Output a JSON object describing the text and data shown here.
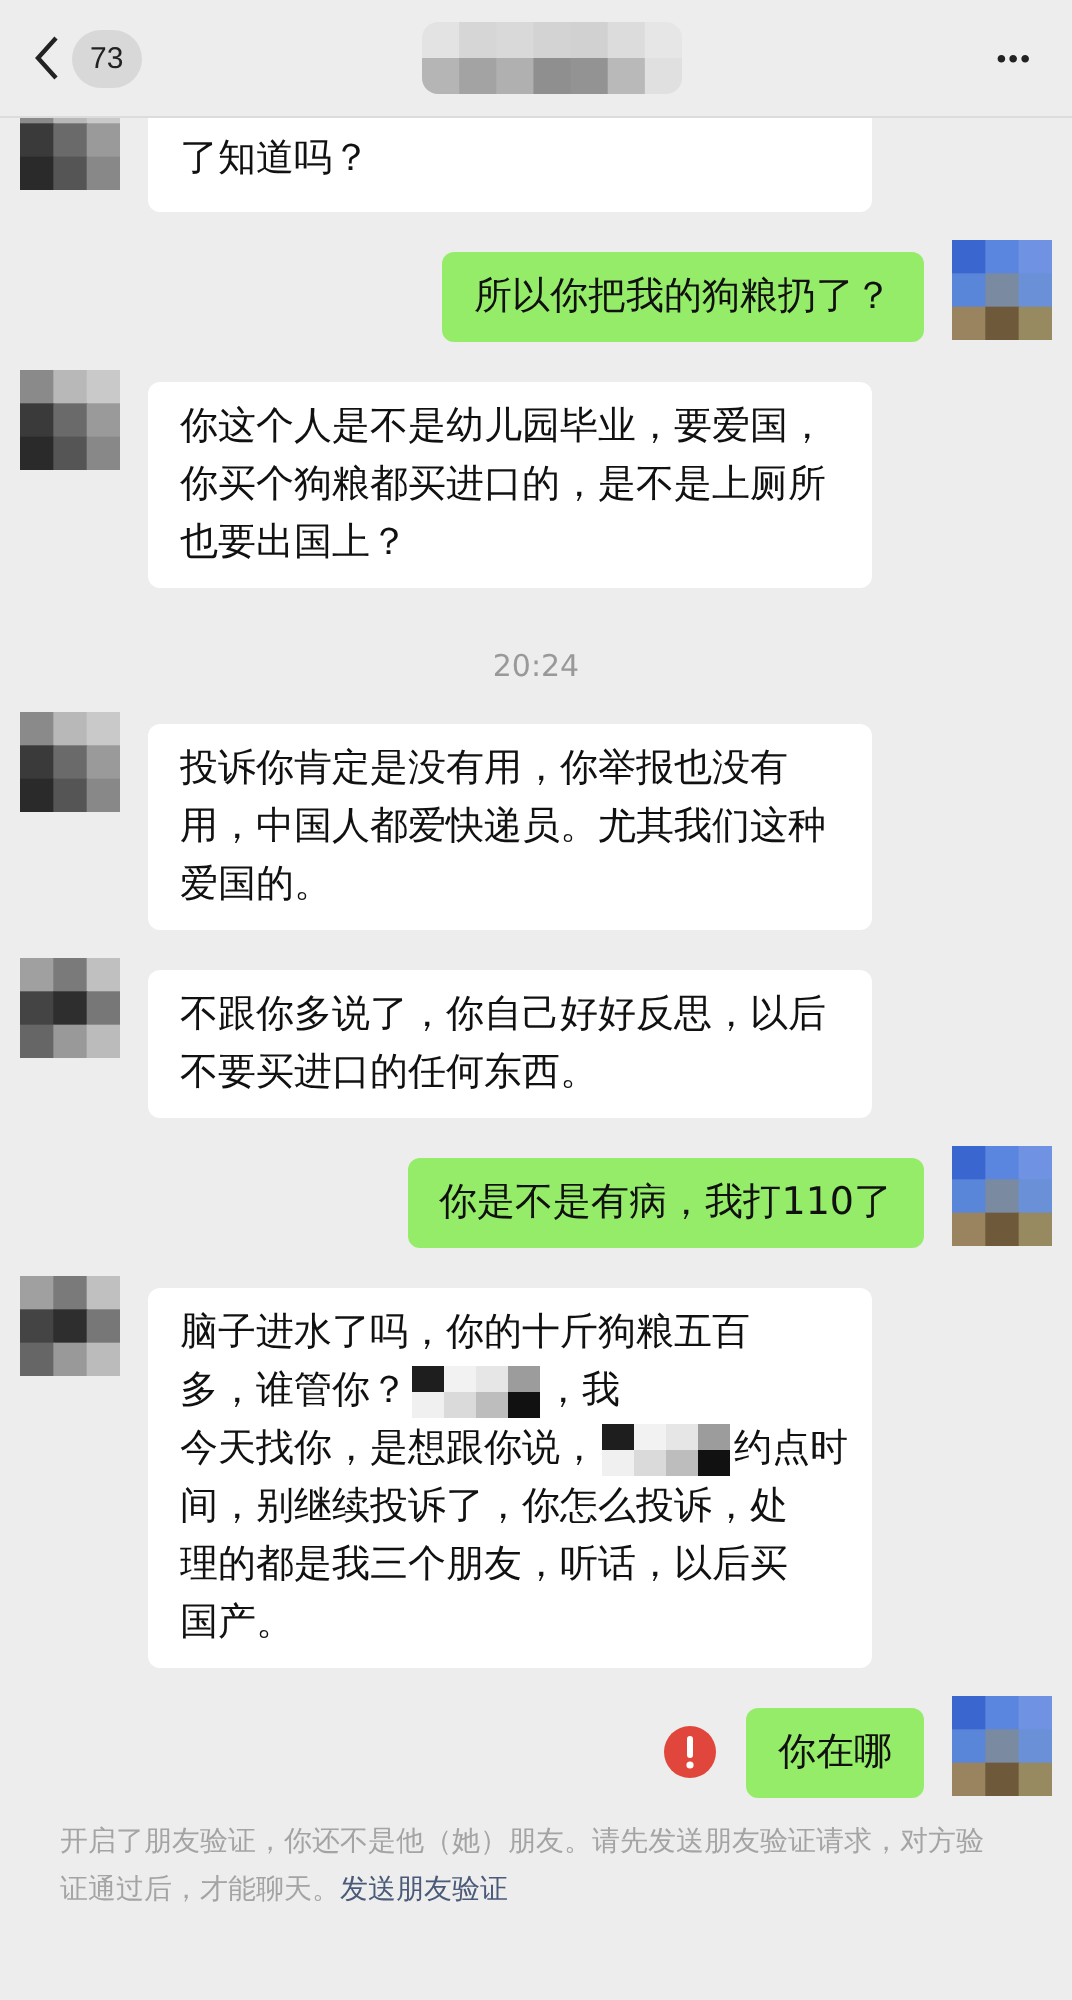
{
  "header": {
    "back_count": "73",
    "more": "•••"
  },
  "messages": [
    {
      "kind": "incoming",
      "text": "了知道吗？"
    },
    {
      "kind": "outgoing",
      "text": "所以你把我的狗粮扔了？"
    },
    {
      "kind": "incoming",
      "text": "你这个人是不是幼儿园毕业，要爱国，你买个狗粮都买进口的，是不是上厕所也要出国上？"
    },
    {
      "kind": "time",
      "text": "20:24"
    },
    {
      "kind": "incoming",
      "text": "投诉你肯定是没有用，你举报也没有用，中国人都爱快递员。尤其我们这种爱国的。"
    },
    {
      "kind": "incoming",
      "text": "不跟你多说了，你自己好好反思，以后不要买进口的任何东西。"
    },
    {
      "kind": "outgoing",
      "text": "你是不是有病，我打110了"
    },
    {
      "kind": "incoming",
      "lines": [
        [
          {
            "kind": "text",
            "text": "脑子进水了吗，你的十斤狗粮五百"
          }
        ],
        [
          {
            "kind": "text",
            "text": "多，谁管你？"
          },
          {
            "kind": "redacted"
          },
          {
            "kind": "text",
            "text": "，我"
          }
        ],
        [
          {
            "kind": "text",
            "text": "今天找你，是想跟你说，"
          },
          {
            "kind": "redacted"
          },
          {
            "kind": "text",
            "text": "约点时"
          }
        ],
        [
          {
            "kind": "text",
            "text": "间，别继续投诉了，你怎么投诉，处"
          }
        ],
        [
          {
            "kind": "text",
            "text": "理的都是我三个朋友，听话，以后买"
          }
        ],
        [
          {
            "kind": "text",
            "text": "国产。"
          }
        ]
      ]
    },
    {
      "kind": "outgoing",
      "failed": true,
      "text": "你在哪"
    }
  ],
  "system_notice": {
    "text": "开启了朋友验证，你还不是他（她）朋友。请先发送朋友验证请求，对方验证通过后，才能聊天。",
    "link": "发送朋友验证"
  }
}
